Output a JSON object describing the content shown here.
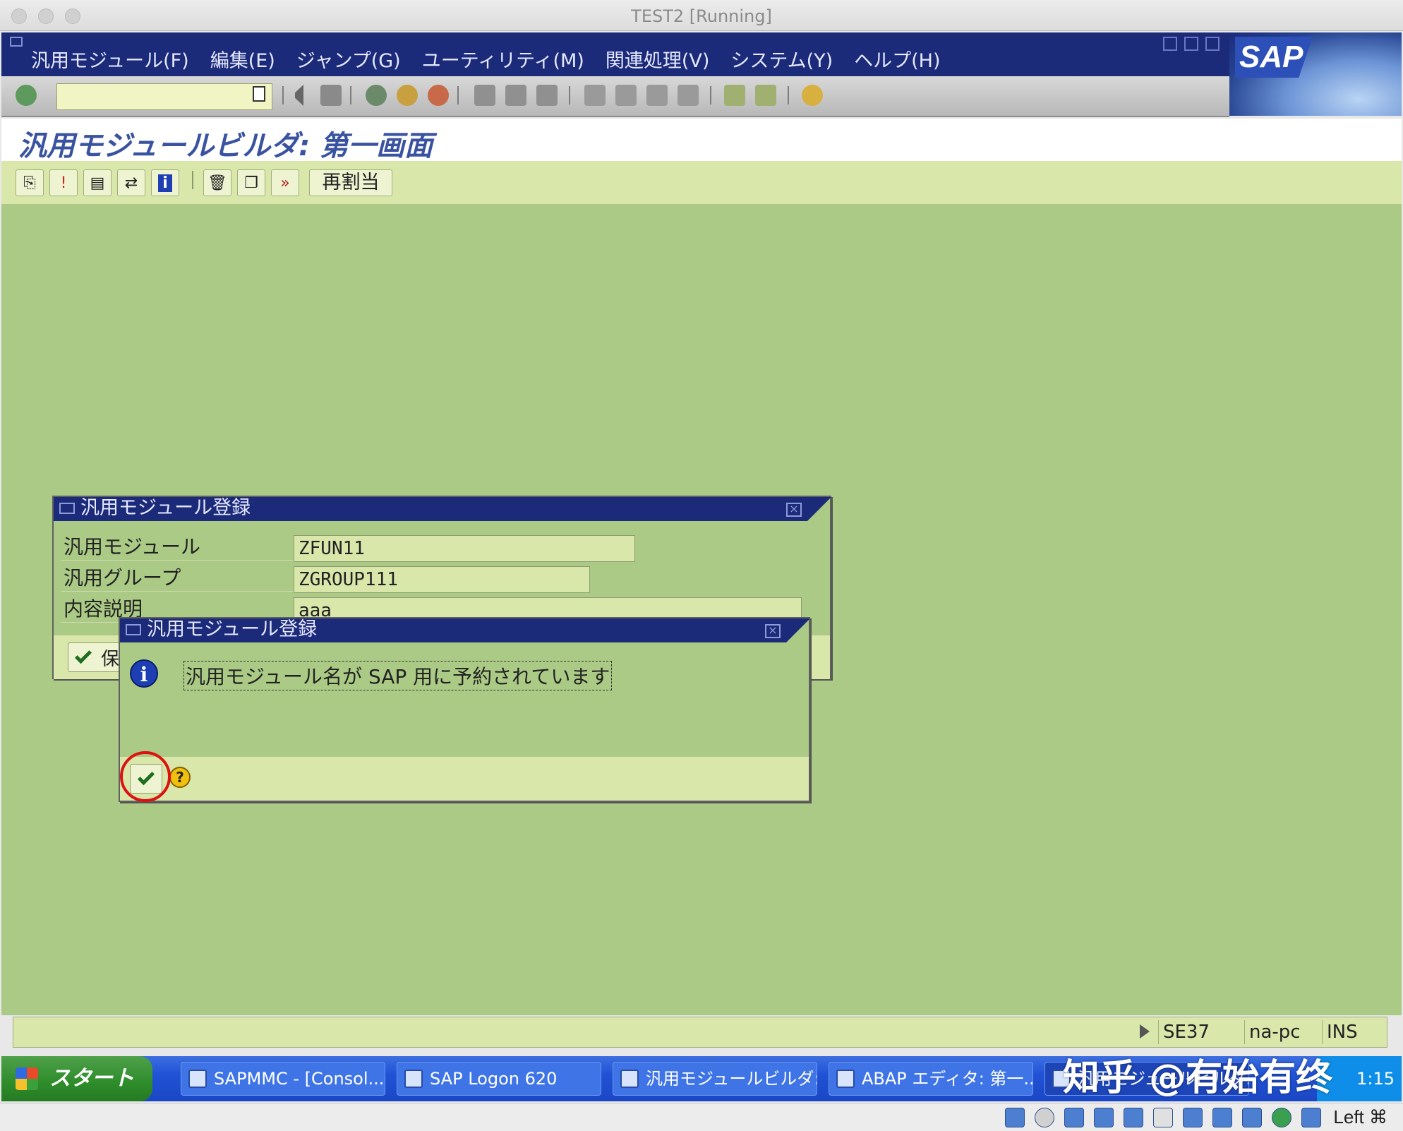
{
  "window": {
    "title": "TEST2 [Running]"
  },
  "menu": {
    "items": [
      "汎用モジュール(F)",
      "編集(E)",
      "ジャンプ(G)",
      "ユーティリティ(M)",
      "関連処理(V)",
      "システム(Y)",
      "ヘルプ(H)"
    ],
    "logo": "SAP"
  },
  "toolbar": {
    "command_field_value": "",
    "icons": [
      "enter-icon",
      "back-icon",
      "save-icon",
      "back-nav-icon",
      "exit-icon",
      "cancel-icon",
      "print-icon",
      "find-icon",
      "find-next-icon",
      "first-page-icon",
      "previous-page-icon",
      "next-page-icon",
      "last-page-icon",
      "create-session-icon",
      "shortcut-icon",
      "help-icon"
    ]
  },
  "screen": {
    "title": "汎用モジュールビルダ: 第一画面"
  },
  "app_toolbar": {
    "icons": [
      "other-object-icon",
      "activate-icon",
      "display-object-list-icon",
      "where-used-icon",
      "info-icon",
      "delete-icon",
      "copy-icon",
      "rename-icon"
    ],
    "reassign_label": "再割当"
  },
  "dialog_register": {
    "title": "汎用モジュール登録",
    "fields": [
      {
        "label": "汎用モジュール",
        "value": "ZFUN11"
      },
      {
        "label": "汎用グループ",
        "value": "ZGROUP111"
      },
      {
        "label": "内容説明",
        "value": "aaa"
      }
    ],
    "save_partial": "保"
  },
  "dialog_info": {
    "title": "汎用モジュール登録",
    "message": "汎用モジュール名が SAP 用に予約されています"
  },
  "status": {
    "transaction": "SE37",
    "server": "na-pc",
    "mode": "INS"
  },
  "taskbar": {
    "start_label": "スタート",
    "items": [
      "SAPMMC - [Consol...",
      "SAP Logon 620",
      "汎用モジュールビルダ: ...",
      "ABAP エディタ: 第一...",
      "汎用モジュールビルダ..."
    ],
    "clock": "1:15"
  },
  "watermark": "知乎 @有始有终",
  "vbox": {
    "host_key": "Left ⌘"
  }
}
